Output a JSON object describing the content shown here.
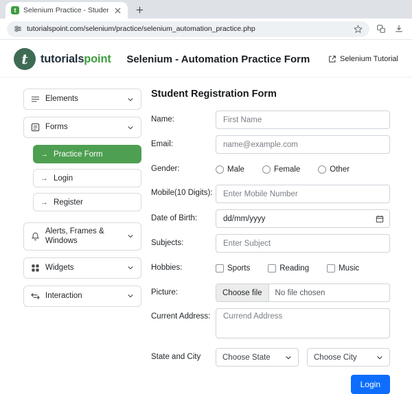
{
  "browser": {
    "tab_title": "Selenium Practice - Student ",
    "url": "tutorialspoint.com/selenium/practice/selenium_automation_practice.php"
  },
  "header": {
    "brand_initial": "t",
    "brand_dark": "tutorials",
    "brand_green": "point",
    "title": "Selenium - Automation Practice Form",
    "tutorial_link": "Selenium Tutorial"
  },
  "sidebar": {
    "items": [
      {
        "label": "Elements"
      },
      {
        "label": "Forms"
      },
      {
        "label": "Alerts, Frames & Windows"
      },
      {
        "label": "Widgets"
      },
      {
        "label": "Interaction"
      }
    ],
    "forms_children": [
      {
        "label": "Practice Form",
        "active": true
      },
      {
        "label": "Login",
        "active": false
      },
      {
        "label": "Register",
        "active": false
      }
    ]
  },
  "form": {
    "title": "Student Registration Form",
    "name": {
      "label": "Name:",
      "placeholder": "First Name"
    },
    "email": {
      "label": "Email:",
      "placeholder": "name@example.com"
    },
    "gender": {
      "label": "Gender:",
      "options": [
        "Male",
        "Female",
        "Other"
      ]
    },
    "mobile": {
      "label": "Mobile(10 Digits):",
      "placeholder": "Enter Mobile Number"
    },
    "dob": {
      "label": "Date of Birth:",
      "value": "dd/mm/yyyy"
    },
    "subjects": {
      "label": "Subjects:",
      "placeholder": "Enter Subject"
    },
    "hobbies": {
      "label": "Hobbies:",
      "options": [
        "Sports",
        "Reading",
        "Music"
      ]
    },
    "picture": {
      "label": "Picture:",
      "button": "Choose file",
      "status": "No file chosen"
    },
    "address": {
      "label": "Current Address:",
      "placeholder": "Currend Address"
    },
    "state_city": {
      "label": "State and City",
      "state": "Choose State",
      "city": "Choose City"
    },
    "submit": "Login"
  },
  "colors": {
    "accent_green": "#4e9f51",
    "brand_green": "#3e9d40",
    "login_blue": "#0d6efd",
    "brand_circle": "#3e6b54"
  }
}
